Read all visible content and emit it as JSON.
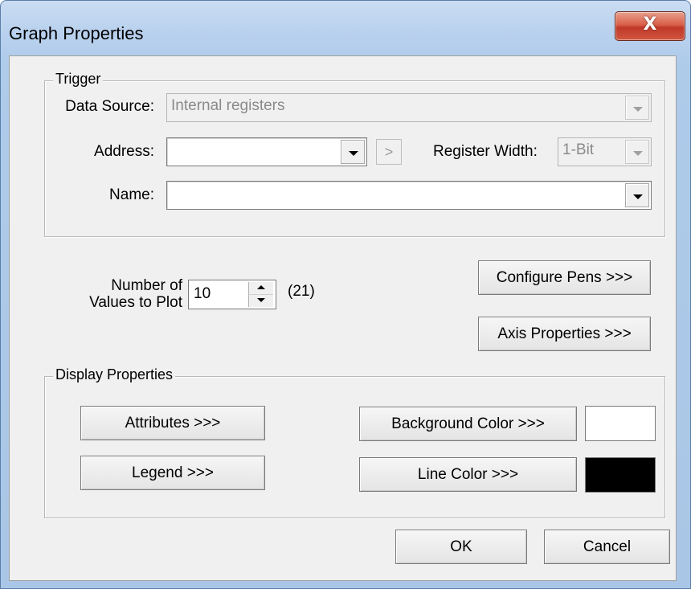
{
  "window": {
    "title": "Graph Properties",
    "close_label": "X"
  },
  "trigger": {
    "legend": "Trigger",
    "data_source_label": "Data Source:",
    "data_source_value": "Internal registers",
    "address_label": "Address:",
    "address_value": "",
    "address_browse_label": ">",
    "register_width_label": "Register Width:",
    "register_width_value": "1-Bit",
    "name_label": "Name:",
    "name_value": ""
  },
  "plot": {
    "number_label_line1": "Number of",
    "number_label_line2": "Values to Plot",
    "number_value": "10",
    "number_note": "(21)"
  },
  "buttons": {
    "configure_pens": "Configure Pens >>>",
    "axis_properties": "Axis Properties >>>",
    "attributes": "Attributes >>>",
    "legend": "Legend >>>",
    "background_color": "Background Color >>>",
    "line_color": "Line Color >>>",
    "ok": "OK",
    "cancel": "Cancel"
  },
  "display": {
    "legend": "Display Properties",
    "background_color_value": "#ffffff",
    "line_color_value": "#000000"
  }
}
